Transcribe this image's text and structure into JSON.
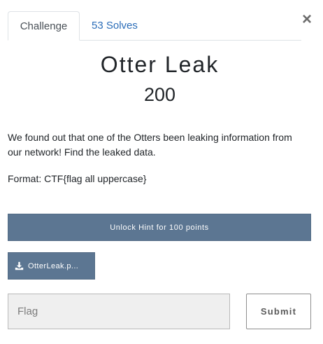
{
  "modal": {
    "close_glyph": "×",
    "tabs": [
      {
        "label": "Challenge",
        "active": true
      },
      {
        "label": "53 Solves",
        "active": false
      }
    ],
    "challenge": {
      "name": "Otter Leak",
      "points": "200",
      "description": "We found out that one of the Otters been leaking information from our network! Find the leaked data.",
      "format": "Format: CTF{flag all uppercase}"
    },
    "hint_button_label": "Unlock Hint for 100 points",
    "file": {
      "label": "OtterLeak.p...",
      "icon": "download-icon"
    },
    "flag_input": {
      "placeholder": "Flag",
      "value": ""
    },
    "submit_label": "Submit"
  },
  "colors": {
    "button_bg": "#5c7692",
    "tab_link": "#2b6db8",
    "input_bg": "#efefef"
  }
}
